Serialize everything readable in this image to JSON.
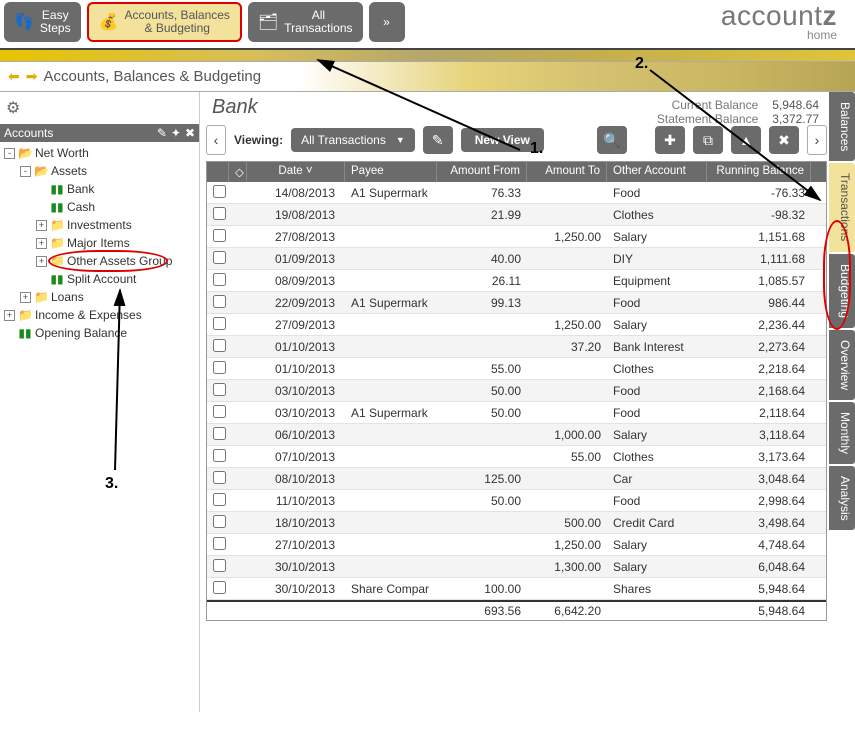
{
  "brand": {
    "name_prefix": "account",
    "name_suffix": "z",
    "sub": "home"
  },
  "nav": {
    "easy_steps": "Easy\nSteps",
    "accounts_budgeting": "Accounts, Balances\n& Budgeting",
    "all_transactions": "All\nTransactions"
  },
  "breadcrumb": "Accounts, Balances & Budgeting",
  "left": {
    "header": "Accounts",
    "tree": [
      {
        "indent": 0,
        "exp": "-",
        "icon": "folder",
        "label": "Net Worth"
      },
      {
        "indent": 1,
        "exp": "-",
        "icon": "folder",
        "label": "Assets"
      },
      {
        "indent": 2,
        "exp": "",
        "icon": "chart",
        "label": "Bank",
        "selected": true
      },
      {
        "indent": 2,
        "exp": "",
        "icon": "chart",
        "label": "Cash"
      },
      {
        "indent": 2,
        "exp": "+",
        "icon": "folder-closed",
        "label": "Investments"
      },
      {
        "indent": 2,
        "exp": "+",
        "icon": "folder-closed",
        "label": "Major Items"
      },
      {
        "indent": 2,
        "exp": "+",
        "icon": "folder-closed",
        "label": "Other Assets Group"
      },
      {
        "indent": 2,
        "exp": "",
        "icon": "chart",
        "label": "Split Account"
      },
      {
        "indent": 1,
        "exp": "+",
        "icon": "folder-closed",
        "label": "Loans"
      },
      {
        "indent": 0,
        "exp": "+",
        "icon": "folder-closed",
        "label": "Income & Expenses"
      },
      {
        "indent": 0,
        "exp": "",
        "icon": "chart",
        "label": "Opening Balance"
      }
    ]
  },
  "center": {
    "title": "Bank",
    "current_label": "Current Balance",
    "current_value": "5,948.64",
    "statement_label": "Statement Balance",
    "statement_value": "3,372.77",
    "viewing_label": "Viewing:",
    "dropdown": "All Transactions",
    "new_view": "New View",
    "columns": {
      "date": "Date",
      "payee": "Payee",
      "afrom": "Amount From",
      "ato": "Amount To",
      "other": "Other Account",
      "run": "Running Balance"
    },
    "rows": [
      {
        "date": "14/08/2013",
        "payee": "A1 Supermark",
        "afrom": "76.33",
        "ato": "",
        "other": "Food",
        "run": "-76.33"
      },
      {
        "date": "19/08/2013",
        "payee": "",
        "afrom": "21.99",
        "ato": "",
        "other": "Clothes",
        "run": "-98.32"
      },
      {
        "date": "27/08/2013",
        "payee": "",
        "afrom": "",
        "ato": "1,250.00",
        "other": "Salary",
        "run": "1,151.68"
      },
      {
        "date": "01/09/2013",
        "payee": "",
        "afrom": "40.00",
        "ato": "",
        "other": "DIY",
        "run": "1,111.68"
      },
      {
        "date": "08/09/2013",
        "payee": "",
        "afrom": "26.11",
        "ato": "",
        "other": "Equipment",
        "run": "1,085.57"
      },
      {
        "date": "22/09/2013",
        "payee": "A1 Supermark",
        "afrom": "99.13",
        "ato": "",
        "other": "Food",
        "run": "986.44"
      },
      {
        "date": "27/09/2013",
        "payee": "",
        "afrom": "",
        "ato": "1,250.00",
        "other": "Salary",
        "run": "2,236.44"
      },
      {
        "date": "01/10/2013",
        "payee": "",
        "afrom": "",
        "ato": "37.20",
        "other": "Bank Interest",
        "run": "2,273.64"
      },
      {
        "date": "01/10/2013",
        "payee": "",
        "afrom": "55.00",
        "ato": "",
        "other": "Clothes",
        "run": "2,218.64"
      },
      {
        "date": "03/10/2013",
        "payee": "",
        "afrom": "50.00",
        "ato": "",
        "other": "Food",
        "run": "2,168.64"
      },
      {
        "date": "03/10/2013",
        "payee": "A1 Supermark",
        "afrom": "50.00",
        "ato": "",
        "other": "Food",
        "run": "2,118.64"
      },
      {
        "date": "06/10/2013",
        "payee": "",
        "afrom": "",
        "ato": "1,000.00",
        "other": "Salary",
        "run": "3,118.64"
      },
      {
        "date": "07/10/2013",
        "payee": "",
        "afrom": "",
        "ato": "55.00",
        "other": "Clothes",
        "run": "3,173.64"
      },
      {
        "date": "08/10/2013",
        "payee": "",
        "afrom": "125.00",
        "ato": "",
        "other": "Car",
        "run": "3,048.64"
      },
      {
        "date": "11/10/2013",
        "payee": "",
        "afrom": "50.00",
        "ato": "",
        "other": "Food",
        "run": "2,998.64"
      },
      {
        "date": "18/10/2013",
        "payee": "",
        "afrom": "",
        "ato": "500.00",
        "other": "Credit Card",
        "run": "3,498.64"
      },
      {
        "date": "27/10/2013",
        "payee": "",
        "afrom": "",
        "ato": "1,250.00",
        "other": "Salary",
        "run": "4,748.64"
      },
      {
        "date": "30/10/2013",
        "payee": "",
        "afrom": "",
        "ato": "1,300.00",
        "other": "Salary",
        "run": "6,048.64"
      },
      {
        "date": "30/10/2013",
        "payee": "Share Compar",
        "afrom": "100.00",
        "ato": "",
        "other": "Shares",
        "run": "5,948.64"
      }
    ],
    "totals": {
      "afrom": "693.56",
      "ato": "6,642.20",
      "run": "5,948.64"
    }
  },
  "tabs": [
    "Balances",
    "Transactions",
    "Budgeting",
    "Overview",
    "Monthly",
    "Analysis"
  ],
  "annotations": {
    "l1": "1.",
    "l2": "2.",
    "l3": "3."
  }
}
